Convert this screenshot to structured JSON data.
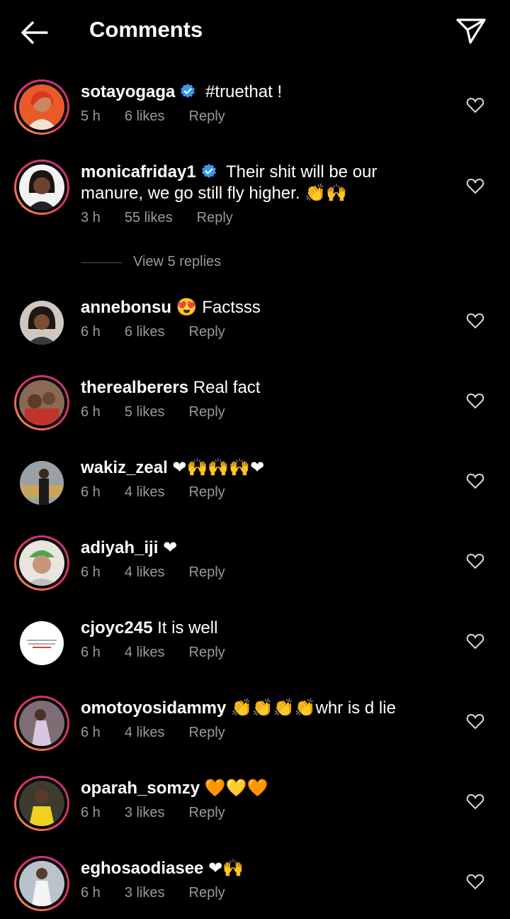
{
  "header": {
    "title": "Comments"
  },
  "icons": {
    "back": "arrow-left-icon",
    "send": "paper-plane-icon",
    "like": "heart-outline-icon",
    "verified": "verified-badge-icon"
  },
  "colors": {
    "background": "#000000",
    "text": "#ffffff",
    "meta": "#9a9a9a",
    "verified": "#3897f0",
    "story_ring": "#e1306c"
  },
  "comments": [
    {
      "username": "sotayogaga",
      "verified": true,
      "text": "#truethat !",
      "time": "5 h",
      "likes": "6 likes",
      "reply": "Reply",
      "avatar": "woman-red-hair-avatar"
    },
    {
      "username": "monicafriday1",
      "verified": true,
      "text": "Their shit will be our manure, we go still fly higher. 👏🙌",
      "time": "3 h",
      "likes": "55 likes",
      "reply": "Reply",
      "avatar": "woman-portrait-avatar"
    },
    {
      "username": "annebonsu",
      "text": "😍 Factsss",
      "time": "6 h",
      "likes": "6 likes",
      "reply": "Reply",
      "avatar": "woman-braids-avatar"
    },
    {
      "username": "therealberers",
      "text": "Real fact",
      "time": "6 h",
      "likes": "5 likes",
      "reply": "Reply",
      "avatar": "people-group-avatar"
    },
    {
      "username": "wakiz_zeal",
      "text": "❤🙌🙌🙌❤",
      "time": "6 h",
      "likes": "4 likes",
      "reply": "Reply",
      "avatar": "man-car-avatar"
    },
    {
      "username": "adiyah_iji",
      "text": "❤",
      "time": "6 h",
      "likes": "4 likes",
      "reply": "Reply",
      "avatar": "woman-green-cap-avatar"
    },
    {
      "username": "cjoyc245",
      "text": "It is well",
      "time": "6 h",
      "likes": "4 likes",
      "reply": "Reply",
      "avatar": "white-text-avatar"
    },
    {
      "username": "omotoyosidammy",
      "text": "👏👏👏👏whr is d lie",
      "time": "6 h",
      "likes": "4 likes",
      "reply": "Reply",
      "avatar": "woman-dress-avatar"
    },
    {
      "username": "oparah_somzy",
      "text": "🧡💛🧡",
      "time": "6 h",
      "likes": "3 likes",
      "reply": "Reply",
      "avatar": "woman-yellow-top-avatar"
    },
    {
      "username": "eghosaodiasee",
      "text": "❤🙌",
      "time": "6 h",
      "likes": "3 likes",
      "reply": "Reply",
      "avatar": "woman-white-dress-avatar"
    }
  ],
  "view_replies": "View 5 replies"
}
